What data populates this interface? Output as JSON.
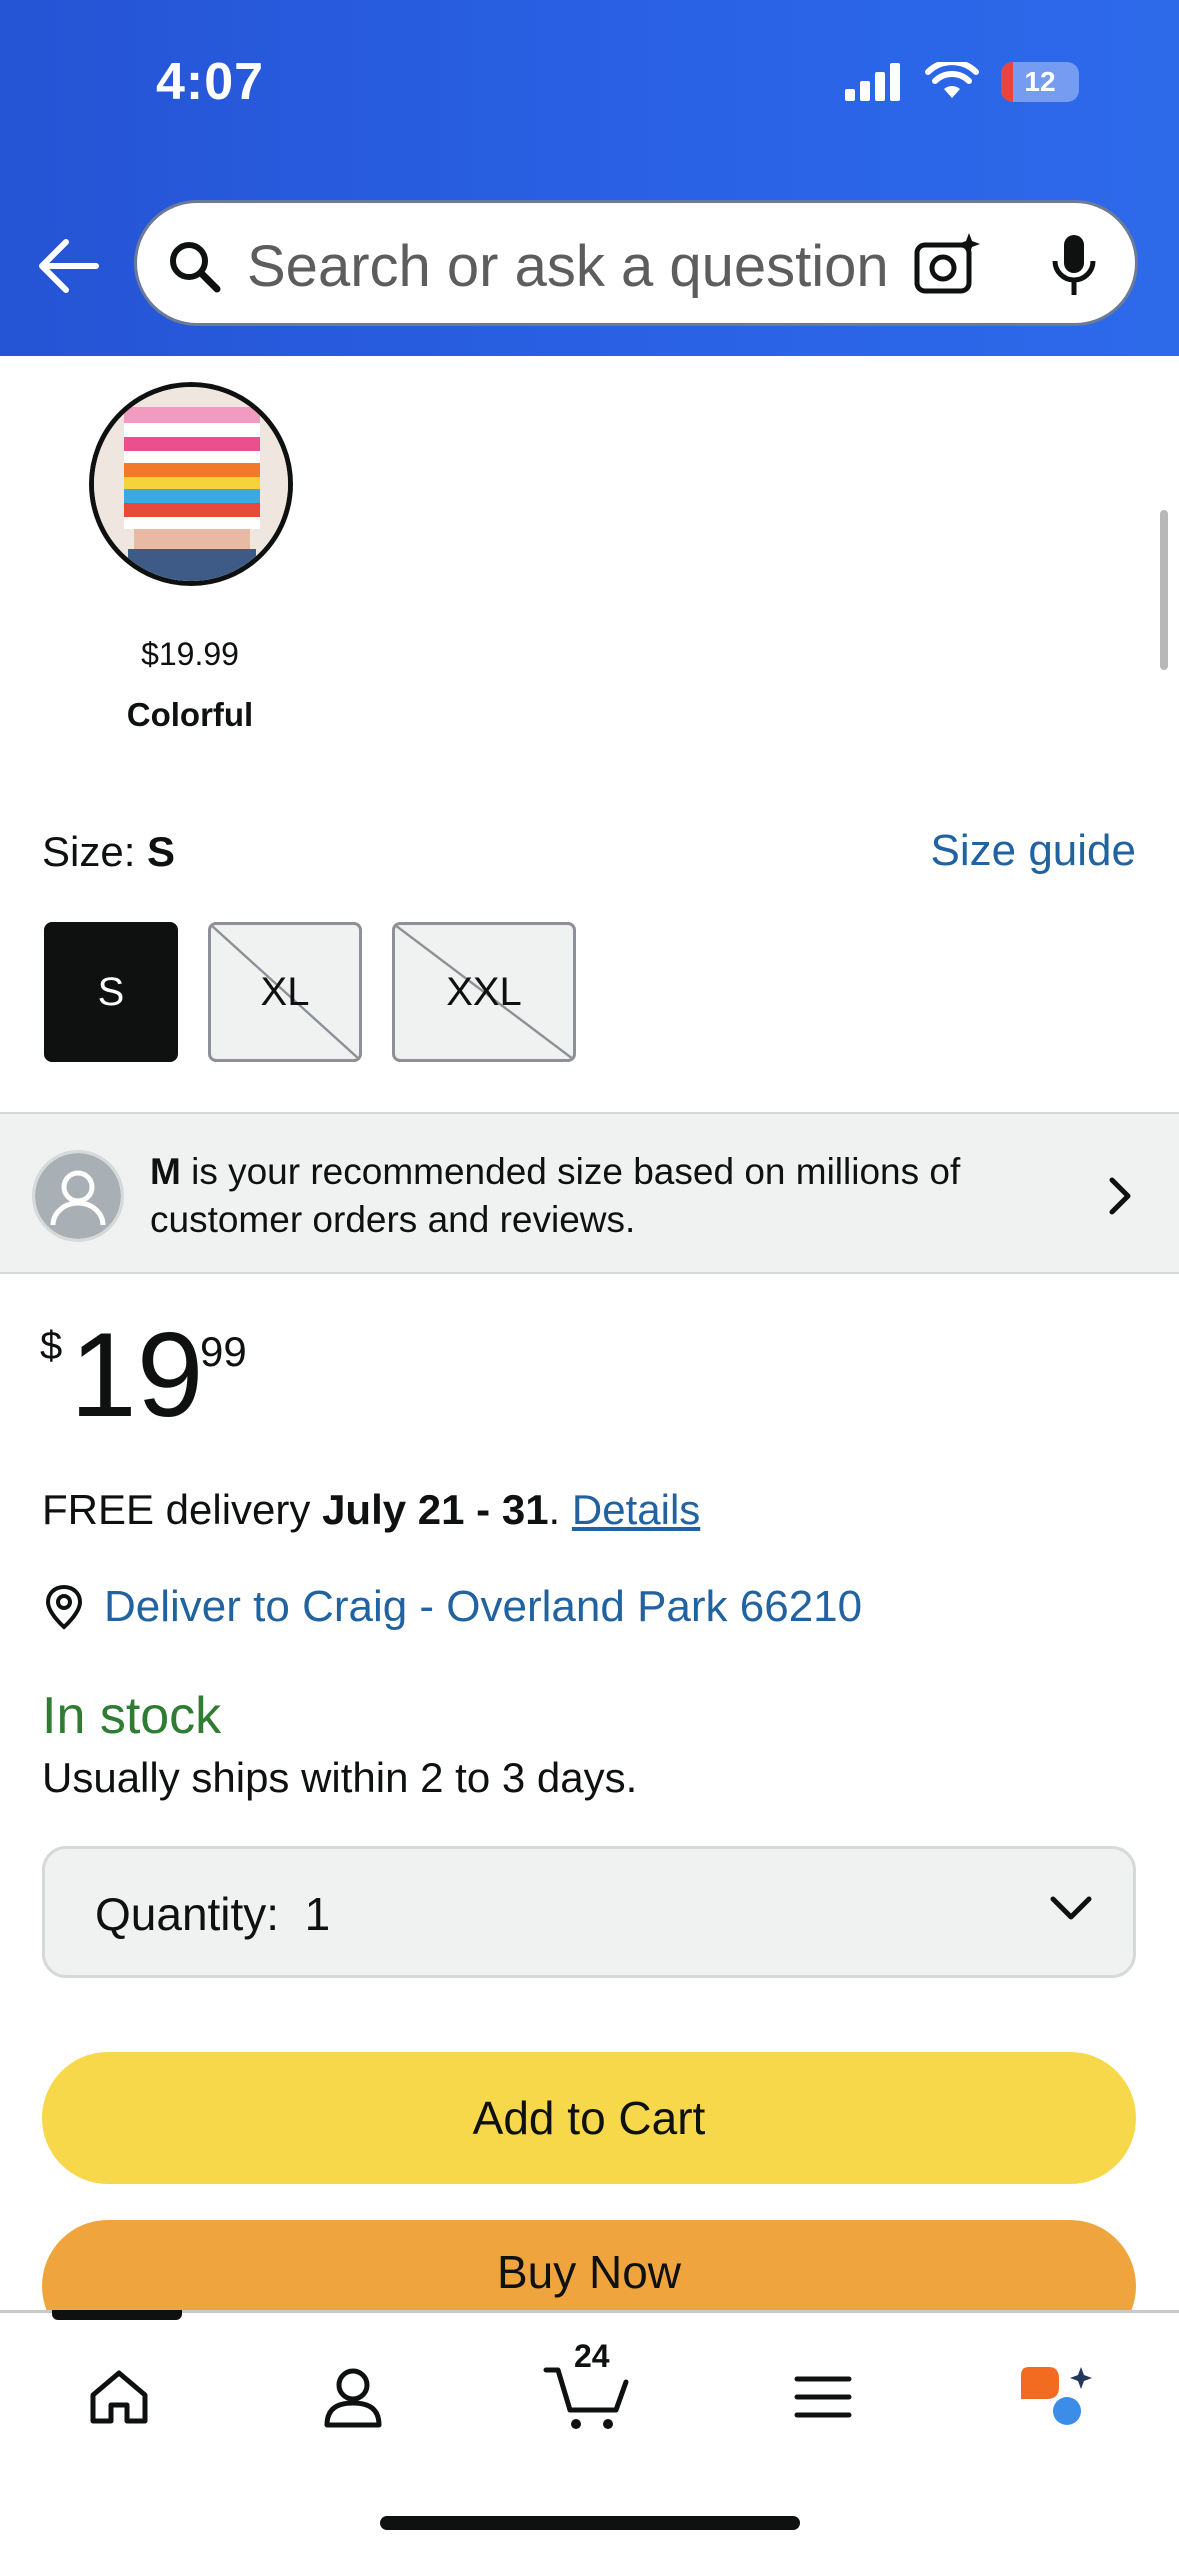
{
  "status_bar": {
    "time": "4:07",
    "battery": "12"
  },
  "search": {
    "placeholder": "Search or ask a question"
  },
  "variant": {
    "price": "$19.99",
    "name": "Colorful"
  },
  "size": {
    "label": "Size: ",
    "selected": "S",
    "guide_label": "Size guide",
    "options": [
      "S",
      "XL",
      "XXL"
    ]
  },
  "recommendation": {
    "size": "M",
    "text": " is your recommended size based on millions of customer orders and reviews."
  },
  "price": {
    "symbol": "$",
    "whole": "19",
    "fraction": "99"
  },
  "delivery": {
    "prefix": "FREE delivery ",
    "dates": "July 21 - 31",
    "sep": ". ",
    "details_link": "Details",
    "deliver_to": "Deliver to Craig - Overland Park 66210"
  },
  "stock": {
    "status": "In stock",
    "ships": "Usually ships within 2 to 3 days."
  },
  "quantity": {
    "label": "Quantity:",
    "value": "1"
  },
  "buttons": {
    "add_to_cart": "Add to Cart",
    "buy_now": "Buy Now"
  },
  "bottom_nav": {
    "items": [
      "home-icon",
      "account-icon",
      "cart-icon",
      "menu-icon",
      "rufus-icon"
    ],
    "cart_count": "24"
  },
  "colors": {
    "header_blue": "#2a5ee0",
    "link_blue": "#2162a1",
    "in_stock_green": "#2e7d32",
    "add_to_cart": "#f7d84a",
    "buy_now": "#f0a43d"
  }
}
